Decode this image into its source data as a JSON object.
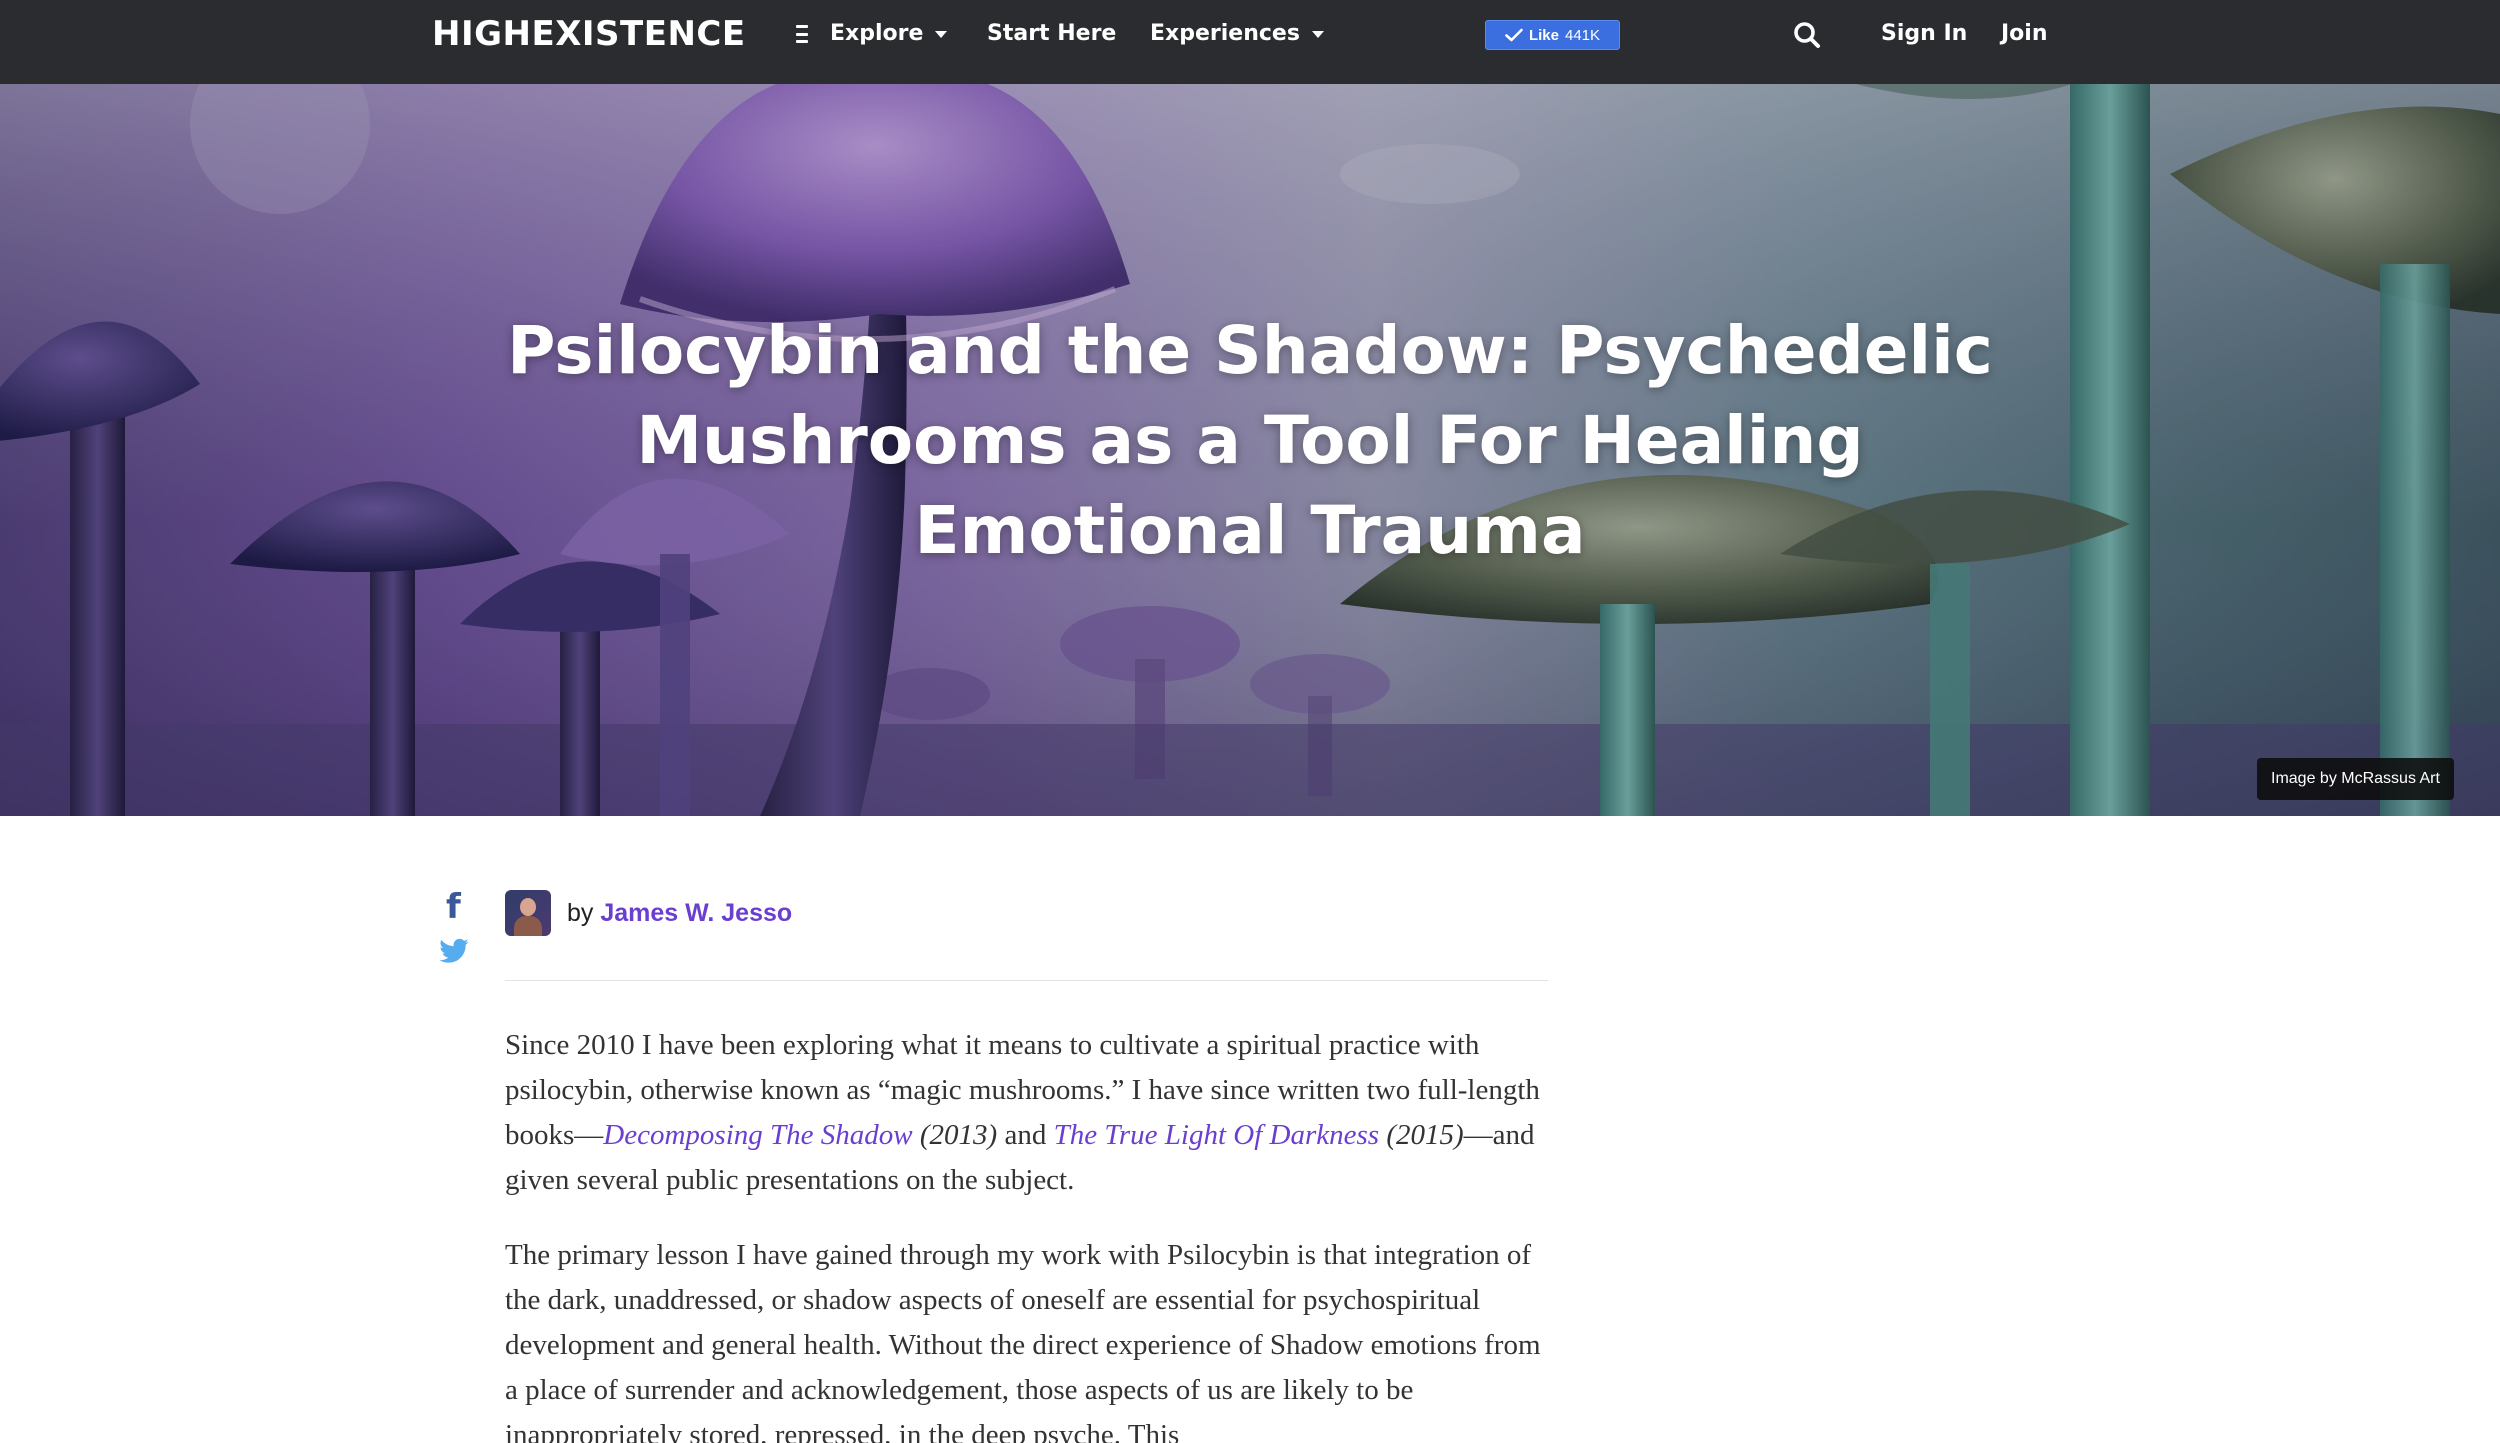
{
  "nav": {
    "logo": "HIGHEXISTENCE",
    "explore": "Explore",
    "start_here": "Start Here",
    "experiences": "Experiences",
    "like_label": "Like",
    "like_count": "441K",
    "sign_in": "Sign In",
    "join": "Join",
    "icons": [
      "hamburger-icon",
      "caret-down-icon",
      "check-icon",
      "search-icon"
    ]
  },
  "hero": {
    "title": "Psilocybin and the Shadow: Psychedelic Mushrooms as a Tool For Healing Emotional Trauma",
    "image_credit": "Image by McRassus Art"
  },
  "share": {
    "icons": [
      "facebook-icon",
      "twitter-icon"
    ],
    "facebook_glyph": "f"
  },
  "author": {
    "prefix": "by",
    "name": "James W. Jesso"
  },
  "article": {
    "p1": {
      "t1": "Since 2010 I have been exploring what it means to cultivate a spiritual practice with psilocybin, otherwise known as “magic mushrooms.” I have since written two full-length books—",
      "link1": "Decomposing The Shadow",
      "y1": "(2013)",
      "t2": " and ",
      "link2": "The True Light Of Darkness",
      "y2": "(2015)",
      "t3": "—and given several public presentations on the subject."
    },
    "p2": "The primary lesson I have gained through my work with Psilocybin is that integration of the dark, unaddressed, or shadow aspects of oneself are essential for psychospiritual development and general health. Without the direct experience of Shadow emotions from a place of surrender and acknowledgement, those aspects of us are likely to be inappropriately stored, repressed, in the deep psyche. This"
  },
  "colors": {
    "nav_bg": "#2a2c2f",
    "link": "#6a3fd0",
    "like_button": "#3b6fe0",
    "facebook": "#3b5998",
    "twitter": "#55acee"
  }
}
